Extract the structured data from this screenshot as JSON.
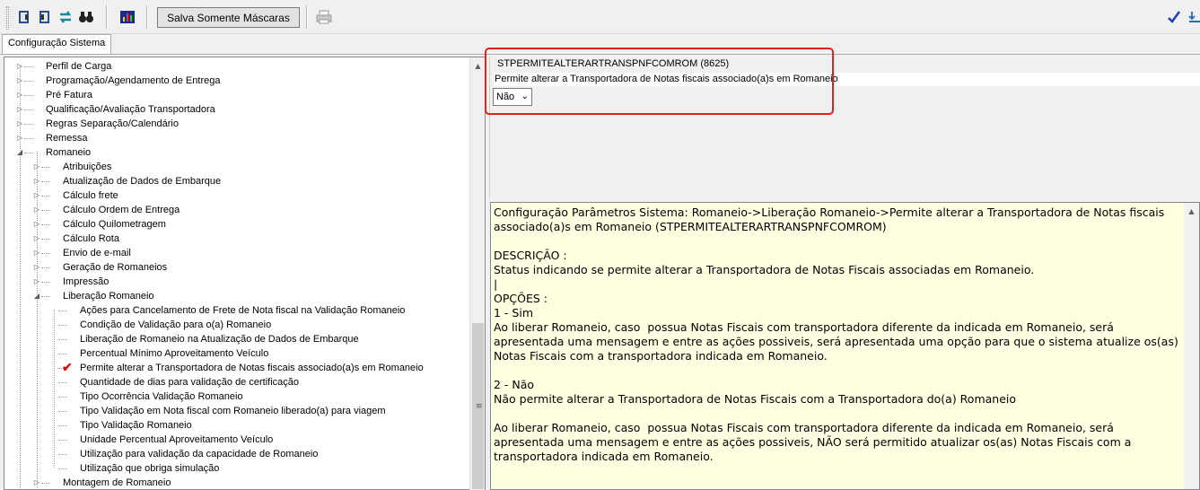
{
  "toolbar": {
    "buttons": [
      {
        "icon": "book-icon"
      },
      {
        "icon": "book-icon"
      },
      {
        "icon": "refresh-icon"
      },
      {
        "icon": "binoculars-icon"
      },
      {
        "icon": "chart-icon"
      }
    ],
    "mask_button_label": "Salva Somente Máscaras",
    "print_icon": "printer-icon",
    "confirm_icon": "checkmark-icon",
    "right_icon": "save-icon"
  },
  "tabs": [
    {
      "label": "Configuração Sistema"
    }
  ],
  "tree": {
    "items": [
      {
        "label": "Perfil de Carga",
        "level": 0,
        "expander": "▷"
      },
      {
        "label": "Programação/Agendamento de Entrega",
        "level": 0,
        "expander": "▷"
      },
      {
        "label": "Pré Fatura",
        "level": 0,
        "expander": "▷"
      },
      {
        "label": "Qualificação/Avaliação Transportadora",
        "level": 0,
        "expander": "▷"
      },
      {
        "label": "Regras Separação/Calendário",
        "level": 0,
        "expander": "▷"
      },
      {
        "label": "Remessa",
        "level": 0,
        "expander": "▷"
      },
      {
        "label": "Romaneio",
        "level": 0,
        "expander": "◢"
      },
      {
        "label": "Atribuições",
        "level": 1,
        "expander": "▷"
      },
      {
        "label": "Atualização de Dados de Embarque",
        "level": 1,
        "expander": "▷"
      },
      {
        "label": "Cálculo frete",
        "level": 1,
        "expander": "▷"
      },
      {
        "label": "Cálculo Ordem de Entrega",
        "level": 1,
        "expander": "▷"
      },
      {
        "label": "Cálculo Quilometragem",
        "level": 1,
        "expander": "▷"
      },
      {
        "label": "Cálculo Rota",
        "level": 1,
        "expander": "▷"
      },
      {
        "label": "Envio de e-mail",
        "level": 1,
        "expander": "▷"
      },
      {
        "label": "Geração de Romaneios",
        "level": 1,
        "expander": "▷"
      },
      {
        "label": "Impressão",
        "level": 1,
        "expander": "▷"
      },
      {
        "label": "Liberação Romaneio",
        "level": 1,
        "expander": "◢"
      },
      {
        "label": "Ações para Cancelamento de Frete de Nota fiscal na Validação Romaneio",
        "level": 2
      },
      {
        "label": "Condição de Validação para o(a) Romaneio",
        "level": 2
      },
      {
        "label": "Liberação de Romaneio na Atualização de Dados de Embarque",
        "level": 2
      },
      {
        "label": "Percentual Mínimo Aproveitamento Veículo",
        "level": 2
      },
      {
        "label": "Permite alterar a Transportadora de Notas fiscais associado(a)s em Romaneio",
        "level": 2,
        "checked": true
      },
      {
        "label": "Quantidade de dias para validação de certificação",
        "level": 2
      },
      {
        "label": "Tipo Ocorrência Validação Romaneio",
        "level": 2
      },
      {
        "label": "Tipo Validação em Nota fiscal com Romaneio liberado(a) para viagem",
        "level": 2
      },
      {
        "label": "Tipo Validação Romaneio",
        "level": 2
      },
      {
        "label": "Unidade Percentual Aproveitamento Veículo",
        "level": 2
      },
      {
        "label": "Utilização para validação da capacidade de Romaneio",
        "level": 2
      },
      {
        "label": "Utilização que obriga simulação",
        "level": 2
      },
      {
        "label": "Montagem de Romaneio",
        "level": 1,
        "expander": "▷"
      }
    ]
  },
  "parameter": {
    "code_label": "STPERMITEALTERARTRANSPNFCOMROM (8625)",
    "description": "Permite alterar a Transportadora de Notas fiscais associado(a)s em Romaneio",
    "value": "Não"
  },
  "description_box": {
    "text": "Configuração Parâmetros Sistema: Romaneio->Liberação Romaneio->Permite alterar a Transportadora de Notas fiscais associado(a)s em Romaneio (STPERMITEALTERARTRANSPNFCOMROM)\n\nDESCRIÇÃO :\nStatus indicando se permite alterar a Transportadora de Notas Fiscais associadas em Romaneio.\n|\nOPÇÕES :\n1 - Sim\nAo liberar Romaneio, caso  possua Notas Fiscais com transportadora diferente da indicada em Romaneio, será apresentada uma mensagem e entre as ações possiveis, será apresentada uma opção para que o sistema atualize os(as) Notas Fiscais com a transportadora indicada em Romaneio.\n\n2 - Não\nNão permite alterar a Transportadora de Notas Fiscais com a Transportadora do(a) Romaneio\n\nAo liberar Romaneio, caso  possua Notas Fiscais com transportadora diferente da indicada em Romaneio, será apresentada uma mensagem e entre as ações possiveis, NÃO será permitido atualizar os(as) Notas Fiscais com a transportadora indicada em Romaneio."
  },
  "colors": {
    "highlight": "#e02020",
    "description_bg": "#ffffe1",
    "check": "#dd1111"
  }
}
